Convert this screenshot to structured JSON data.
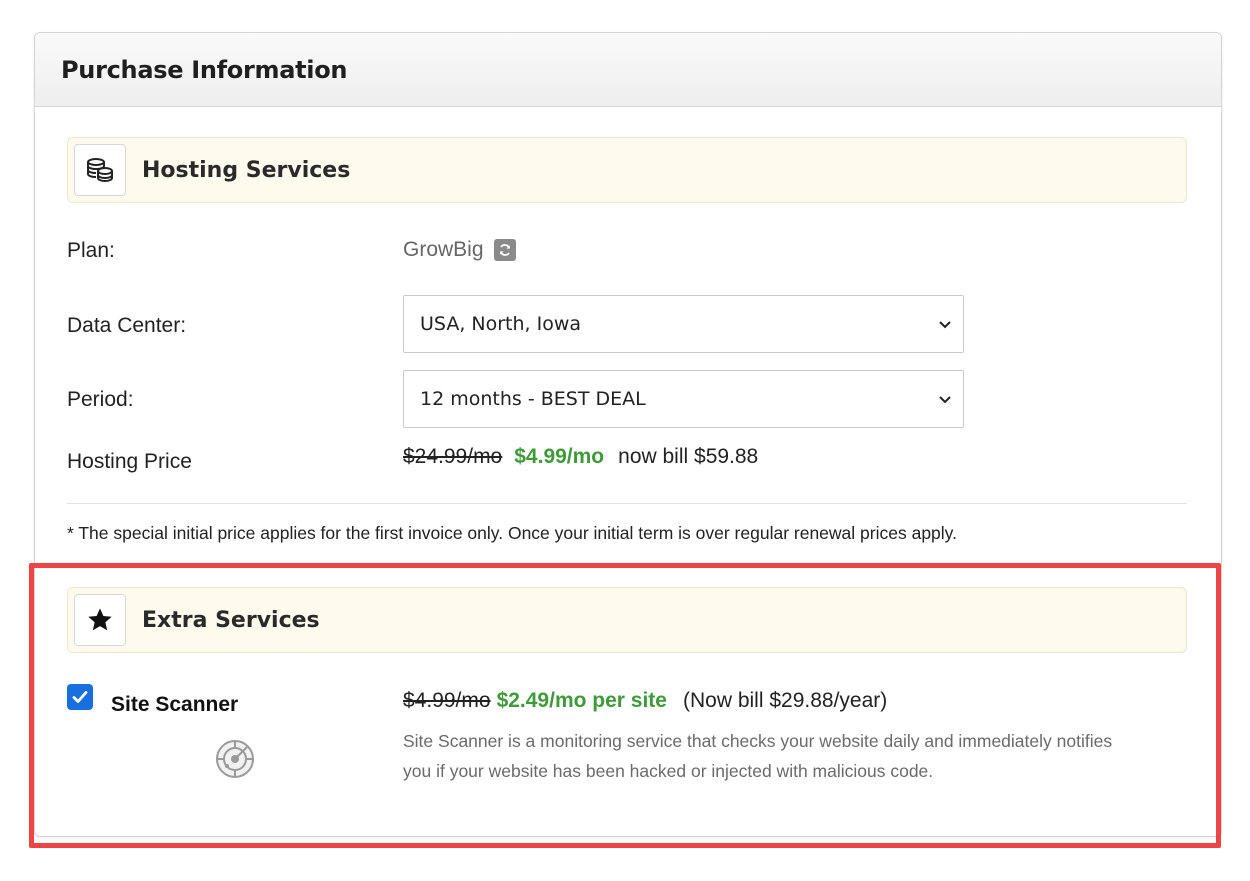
{
  "card": {
    "title": "Purchase Information"
  },
  "hosting": {
    "section_title": "Hosting Services",
    "section_icon": "coins-stack-icon",
    "plan_label": "Plan:",
    "plan_value": "GrowBig",
    "datacenter_label": "Data Center:",
    "datacenter_value": "USA, North, Iowa",
    "period_label": "Period:",
    "period_value": "12 months - BEST DEAL",
    "price_label": "Hosting Price",
    "price_old": "$24.99/mo",
    "price_new": "$4.99/mo",
    "price_bill": "now bill $59.88",
    "note": "* The special initial price applies for the first invoice only. Once your initial term is over regular renewal prices apply."
  },
  "extra": {
    "section_title": "Extra Services",
    "section_icon": "star-icon",
    "scanner_label": "Site Scanner",
    "scanner_checked": true,
    "price_old": "$4.99/mo",
    "price_new": "$2.49/mo per site",
    "price_bill": "(Now bill $29.88/year)",
    "description": "Site Scanner is a monitoring service that checks your website daily and immediately notifies you if your website has been hacked or injected with malicious code."
  },
  "colors": {
    "accent_green": "#3f9a3a",
    "checkbox_blue": "#1a6fe0",
    "highlight_red": "#ee4444",
    "section_bg": "#fefbee"
  }
}
